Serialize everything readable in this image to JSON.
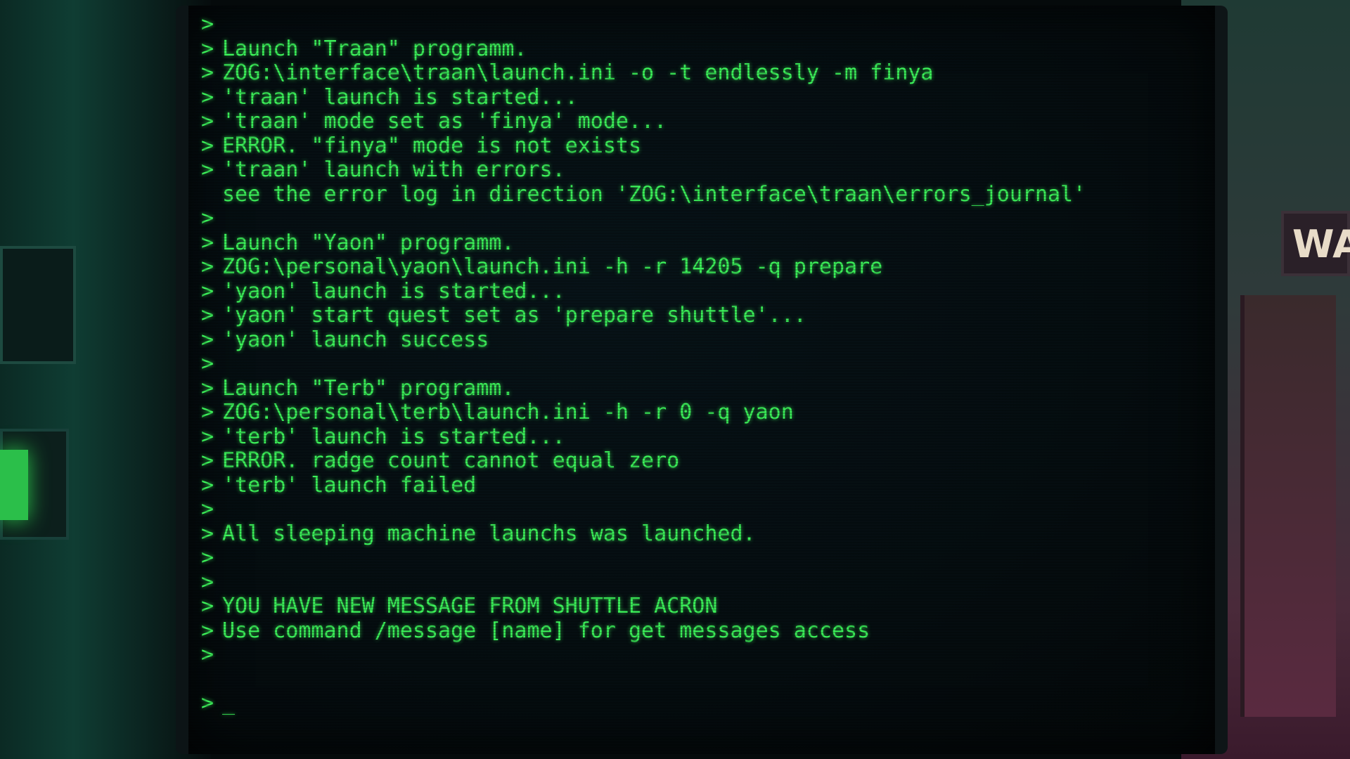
{
  "terminal": {
    "prompt": ">",
    "lines": [
      {
        "p": true,
        "text": ""
      },
      {
        "p": true,
        "text": "Launch \"Traan\" programm."
      },
      {
        "p": true,
        "text": "ZOG:\\interface\\traan\\launch.ini -o -t endlessly -m finya"
      },
      {
        "p": true,
        "text": "'traan' launch is started..."
      },
      {
        "p": true,
        "text": "'traan' mode set as 'finya' mode..."
      },
      {
        "p": true,
        "text": "ERROR. \"finya\" mode is not exists"
      },
      {
        "p": true,
        "text": "'traan' launch with errors."
      },
      {
        "p": false,
        "text": "see the error log in direction 'ZOG:\\interface\\traan\\errors_journal'"
      },
      {
        "p": true,
        "text": ""
      },
      {
        "p": true,
        "text": "Launch \"Yaon\" programm."
      },
      {
        "p": true,
        "text": "ZOG:\\personal\\yaon\\launch.ini -h -r 14205 -q prepare"
      },
      {
        "p": true,
        "text": "'yaon' launch is started..."
      },
      {
        "p": true,
        "text": "'yaon' start quest set as 'prepare shuttle'..."
      },
      {
        "p": true,
        "text": "'yaon' launch success"
      },
      {
        "p": true,
        "text": ""
      },
      {
        "p": true,
        "text": "Launch \"Terb\" programm."
      },
      {
        "p": true,
        "text": "ZOG:\\personal\\terb\\launch.ini -h -r 0 -q yaon"
      },
      {
        "p": true,
        "text": "'terb' launch is started..."
      },
      {
        "p": true,
        "text": "ERROR. radge count cannot equal zero"
      },
      {
        "p": true,
        "text": "'terb' launch failed"
      },
      {
        "p": true,
        "text": ""
      },
      {
        "p": true,
        "text": "All sleeping machine launchs was launched."
      },
      {
        "p": true,
        "text": ""
      },
      {
        "p": true,
        "text": ""
      },
      {
        "p": true,
        "text": "YOU HAVE NEW MESSAGE FROM SHUTTLE ACRON"
      },
      {
        "p": true,
        "text": "Use command /message [name] for get messages access"
      },
      {
        "p": true,
        "text": ""
      },
      {
        "p": false,
        "text": ""
      }
    ],
    "input_prompt": ">",
    "cursor": "_"
  },
  "scene": {
    "sign_text": "WA"
  },
  "colors": {
    "terminal_text": "#3cf25a",
    "screen_bg": "#050d10"
  }
}
